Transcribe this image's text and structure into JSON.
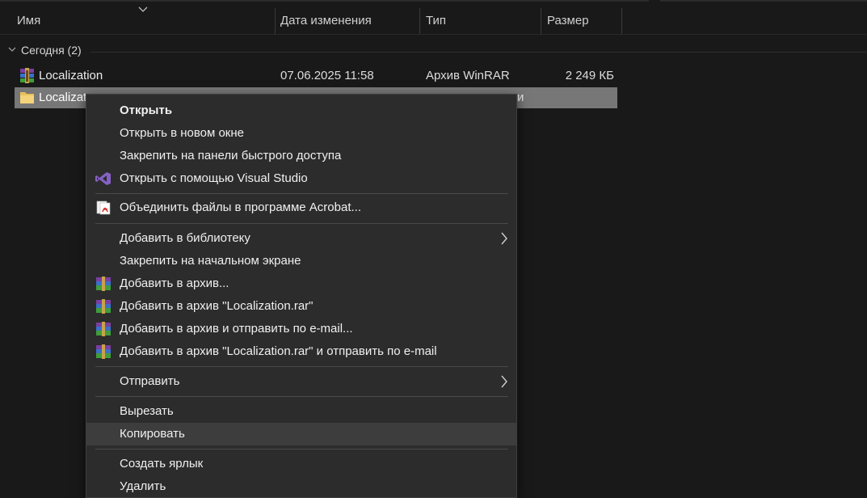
{
  "columns": {
    "name": "Имя",
    "date": "Дата изменения",
    "type": "Тип",
    "size": "Размер"
  },
  "group": {
    "label": "Сегодня (2)"
  },
  "files": [
    {
      "name": "Localization",
      "date": "07.06.2025 11:58",
      "type": "Архив WinRAR",
      "size": "2 249 КБ",
      "icon": "winrar-archive-icon"
    },
    {
      "name": "Localizat",
      "type_partial": "и",
      "icon": "folder-icon",
      "selected": true
    }
  ],
  "context_menu": {
    "items": [
      {
        "label": "Открыть",
        "bold": true
      },
      {
        "label": "Открыть в новом окне"
      },
      {
        "label": "Закрепить на панели быстрого доступа"
      },
      {
        "label": "Открыть с помощью Visual Studio",
        "icon": "visual-studio-icon"
      },
      {
        "label": "Объединить файлы в программе Acrobat...",
        "icon": "acrobat-icon"
      },
      {
        "label": "Добавить в библиотеку",
        "submenu": true
      },
      {
        "label": "Закрепить на начальном экране"
      },
      {
        "label": "Добавить в архив...",
        "icon": "winrar-icon"
      },
      {
        "label": "Добавить в архив \"Localization.rar\"",
        "icon": "winrar-icon"
      },
      {
        "label": "Добавить в архив и отправить по e-mail...",
        "icon": "winrar-icon"
      },
      {
        "label": "Добавить в архив \"Localization.rar\" и отправить по e-mail",
        "icon": "winrar-icon"
      },
      {
        "label": "Отправить",
        "submenu": true
      },
      {
        "label": "Вырезать"
      },
      {
        "label": "Копировать",
        "hovered": true
      },
      {
        "label": "Создать ярлык"
      },
      {
        "label": "Удалить"
      }
    ]
  },
  "colors": {
    "background": "#191919",
    "menu_bg": "#2c2c2c",
    "selected_row": "#777777",
    "hover_item": "#3d3d3d"
  }
}
